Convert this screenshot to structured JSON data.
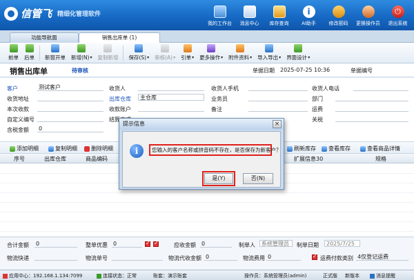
{
  "app": {
    "name": "信管飞",
    "slogan": "精细化管理软件"
  },
  "top_nav": [
    {
      "label": "我的工作台",
      "icon": "desktop-icon"
    },
    {
      "label": "消息中心",
      "icon": "message-icon"
    },
    {
      "label": "库存查询",
      "icon": "stock-icon"
    },
    {
      "label": "AI助手",
      "icon": "ai-assistant-icon"
    },
    {
      "label": "修改密码",
      "icon": "key-icon"
    },
    {
      "label": "更换操作员",
      "icon": "user-switch-icon"
    },
    {
      "label": "退出系统",
      "icon": "power-icon"
    }
  ],
  "tabs": [
    {
      "label": "功能导航面"
    },
    {
      "label": "销售出库单 (1)"
    }
  ],
  "toolbar": {
    "prev": "前单",
    "next": "后单",
    "new_window": "新窗开单",
    "new_add": "新增(N)",
    "copy_add": "复制新增",
    "save": "保存(S)",
    "audit": "审核(A)",
    "import_ref": "引单",
    "more": "更多操作",
    "attachment": "附件资料",
    "import_export": "导入导出",
    "ui_design": "界面设计"
  },
  "document": {
    "title": "销售出库单",
    "status": "待审核",
    "date_label": "单据日期",
    "date_value": "2025-07-25 10:36",
    "number_label": "单据编号"
  },
  "form": {
    "customer_label": "客户",
    "customer_value": "测试客户",
    "ship_address_label": "收货地址",
    "this_receive_label": "本次收款",
    "custom_no_label": "自定义编号",
    "tax_amount_label": "含税金额",
    "tax_amount_value": "0",
    "receiver_label": "收货人",
    "warehouse_label": "出库仓库",
    "warehouse_value": "主仓库",
    "receive_account_label": "收款账户",
    "settle_label": "结算方式",
    "receiver_phone_label": "收货人手机",
    "salesman_label": "业务员",
    "remark_label": "备注",
    "receiver_tel_label": "收货人电话",
    "dept_label": "部门",
    "freight_label": "运费",
    "tariff_label": "关税"
  },
  "detail_tools": {
    "add": "添加明细",
    "copy": "复制明细",
    "delete": "删除明细",
    "refresh_stock": "刷新库存",
    "view_stock": "查看库存",
    "view_detail": "查看商品详情"
  },
  "grid_columns": {
    "seq": "序号",
    "warehouse": "出库仓库",
    "product_code": "商品编码",
    "ext_info": "扩展信息30",
    "spec": "规格"
  },
  "footer": {
    "total_label": "合计金额",
    "total_value": "0",
    "discount_label": "整单优惠",
    "discount_value": "0",
    "receivable_label": "应收金额",
    "receivable_value": "0",
    "maker_label": "制单人",
    "maker_value": "系统管理员",
    "make_date_label": "制单日期",
    "make_date_value": "2025/7/25",
    "express_label": "物流快递",
    "waybill_label": "物流单号",
    "cod_label": "物流代收金额",
    "cod_value": "0",
    "logistics_fee_label": "物流费用",
    "logistics_fee_value": "0",
    "freight_payer_label": "运费付款类别",
    "freight_payer_value": "4仅登记运费"
  },
  "statusbar": {
    "app_center": "应用中心：192.168.1.134:7099",
    "connection": "连接状态：正常",
    "account": "账套：演示账套",
    "operator": "操作员：系统管理员(admin)",
    "edition": "正式版",
    "new_version": "新版本",
    "remind": "消息提醒"
  },
  "dialog": {
    "title": "提示信息",
    "message": "您输入的客户名称或拼音码不存在，是否保存为新客户？",
    "yes": "是(Y)",
    "no": "否(N)",
    "close": "×"
  }
}
